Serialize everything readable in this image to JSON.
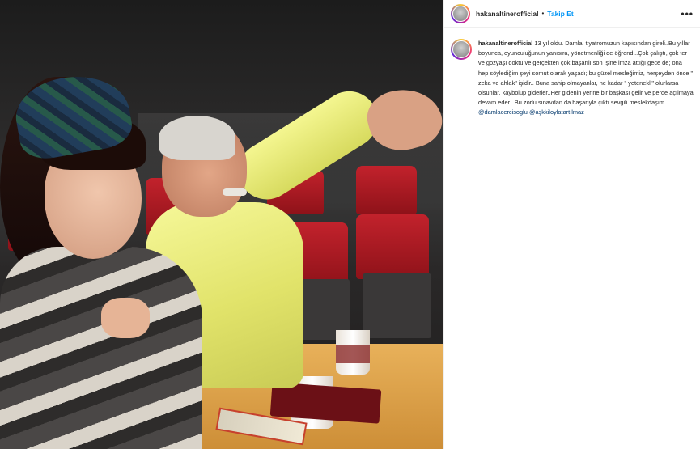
{
  "colors": {
    "accent": "#0095f6",
    "text": "#262626",
    "mention": "#00376b",
    "border": "#efefef"
  },
  "post": {
    "photo_icon": "post-photo",
    "header": {
      "username": "hakanaltinerofficial",
      "separator": "•",
      "follow_label": "Takip Et",
      "more_icon": "more-options-icon",
      "more_label": "•••"
    },
    "caption": {
      "username": "hakanaltinerofficial",
      "text": "13 yıl oldu. Damla, tiyatromuzun kapısından gireli..Bu yıllar boyunca, oyunculuğunun yanısıra, yönetmenliği de öğrendi..Çok çalıştı, çok ter ve gözyaşı döktü ve gerçekten çok başarılı son işine imza attığı gece de; ona hep söylediğim şeyi somut olarak yaşadı; bu güzel mesleğimiz, herşeyden önce \" zeka ve ahlak\" işidir.. Buna sahip olmayanlar, ne kadar \" yetenekli\" olurlarsa olsunlar, kaybolup giderler..Her gidenin yerine bir başkası gelir ve perde açılmaya devam eder.. Bu zorlu sınavdan da başarıyla çıktı sevgili meslekdaşım..",
      "mentions": [
        "@damlacercisoglu",
        "@aşkkiloylatartılmaz"
      ]
    }
  }
}
